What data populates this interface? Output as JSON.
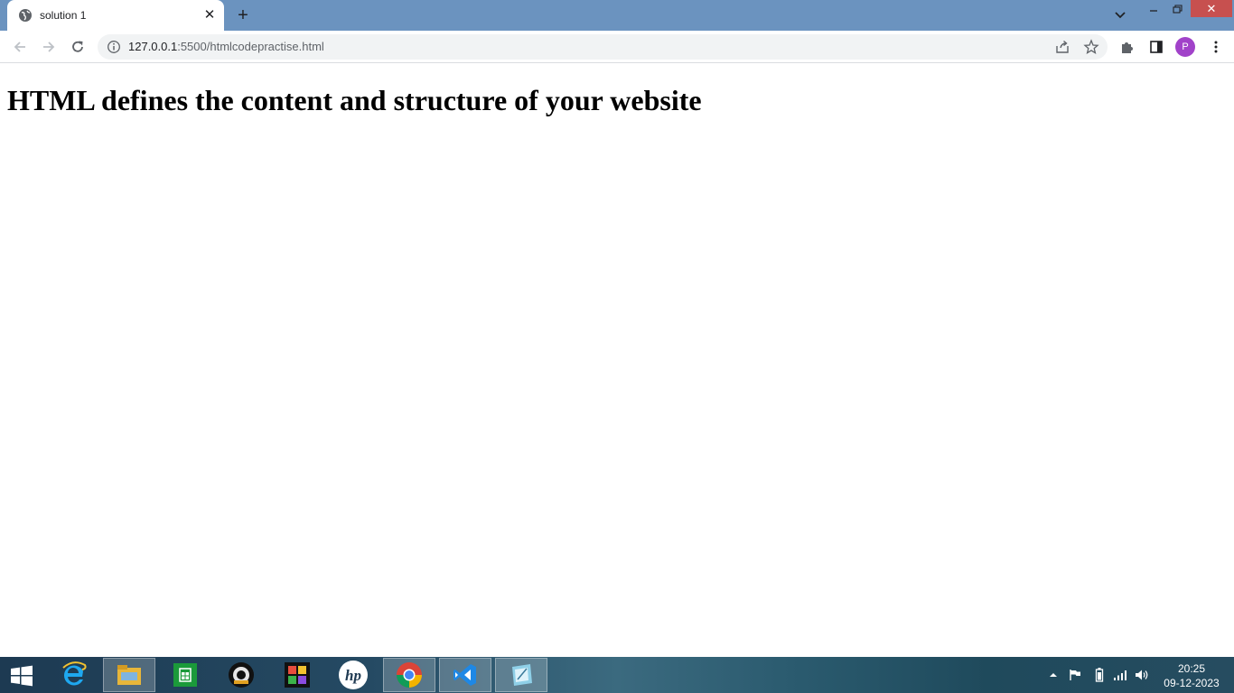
{
  "browser": {
    "tab": {
      "title": "solution 1",
      "favicon": "globe-icon"
    },
    "url": {
      "host": "127.0.0.1",
      "path": ":5500/htmlcodepractise.html"
    },
    "profile_initial": "P",
    "window_close_glyph": "✕"
  },
  "page": {
    "heading": "HTML defines the content and structure of your website"
  },
  "taskbar": {
    "apps": [
      "internet-explorer",
      "file-explorer",
      "store",
      "camera-app",
      "paint-app",
      "hp-app",
      "chrome",
      "vs-code",
      "notes-app"
    ],
    "clock": {
      "time": "20:25",
      "date": "09-12-2023"
    }
  },
  "colors": {
    "titlebar": "#6b93bf",
    "close_button": "#c7504f",
    "avatar": "#a142c9"
  }
}
